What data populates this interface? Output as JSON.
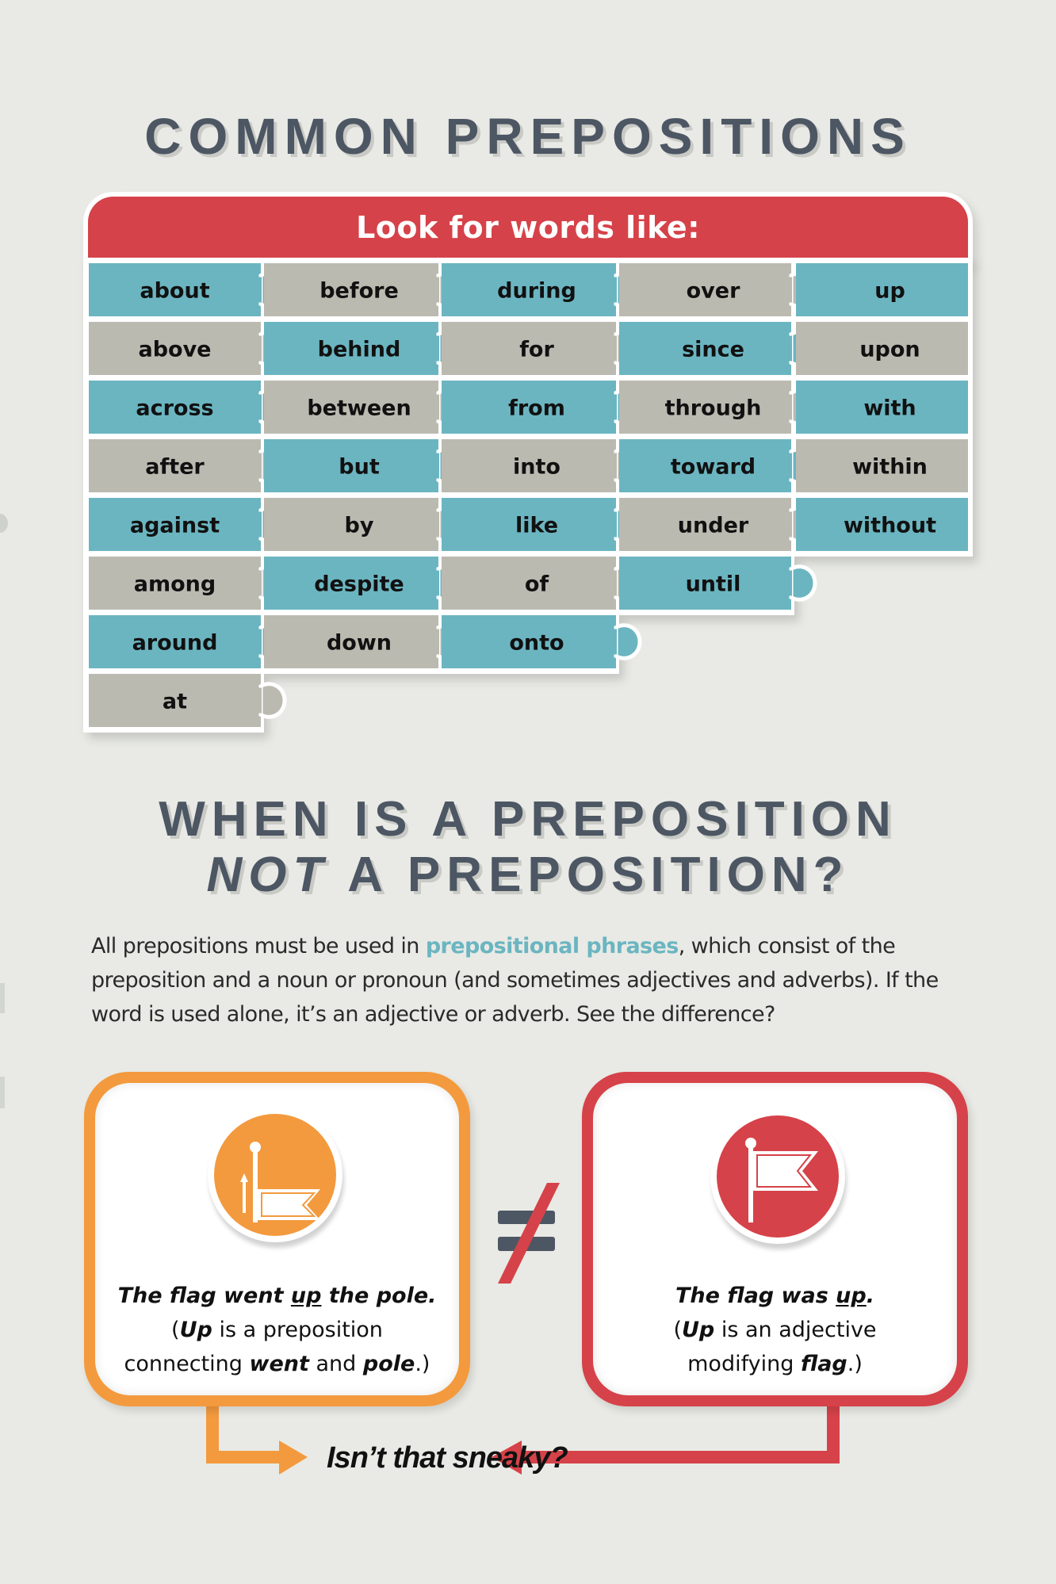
{
  "title": "COMMON PREPOSITIONS",
  "board": {
    "header": "Look for words like:",
    "columns": [
      [
        "about",
        "above",
        "across",
        "after",
        "against",
        "among",
        "around",
        "at"
      ],
      [
        "before",
        "behind",
        "between",
        "but",
        "by",
        "despite",
        "down"
      ],
      [
        "during",
        "for",
        "from",
        "into",
        "like",
        "of",
        "onto"
      ],
      [
        "over",
        "since",
        "through",
        "toward",
        "under",
        "until"
      ],
      [
        "up",
        "upon",
        "with",
        "within",
        "without"
      ]
    ],
    "colors": {
      "teal": "#6bb5c1",
      "gray": "#bbbab1",
      "header": "#d64249"
    }
  },
  "question": {
    "line1": "WHEN IS A PREPOSITION",
    "line2_emphasis": "NOT",
    "line2_rest": " A PREPOSITION?"
  },
  "paragraph": {
    "before": "All prepositions must be used in ",
    "highlight": "prepositional phrases",
    "after": ", which consist of the preposition and a noun or pronoun (and sometimes adjectives and adverbs). If the word is used alone, it’s an adjective or adverb. See the difference?"
  },
  "examples": {
    "left": {
      "icon": "flag-raising-icon",
      "color": "#f39a3e",
      "sentence_pre": "The flag went ",
      "sentence_key": "up",
      "sentence_post": " the pole.",
      "expl_open": "(",
      "expl_key": "Up",
      "expl_mid": " is a preposition",
      "expl_line2_pre": "connecting ",
      "expl_word1": "went",
      "expl_and": " and ",
      "expl_word2": "pole",
      "expl_close": ".)"
    },
    "right": {
      "icon": "flag-icon",
      "color": "#d64249",
      "sentence_pre": "The flag was ",
      "sentence_key": "up",
      "sentence_post": ".",
      "expl_open": "(",
      "expl_key": "Up",
      "expl_mid": " is an adjective",
      "expl_line2_pre": "modifying ",
      "expl_word1": "flag",
      "expl_close": ".)"
    },
    "separator": "not-equal-icon"
  },
  "conclusion": "Isn’t that sneaky?"
}
